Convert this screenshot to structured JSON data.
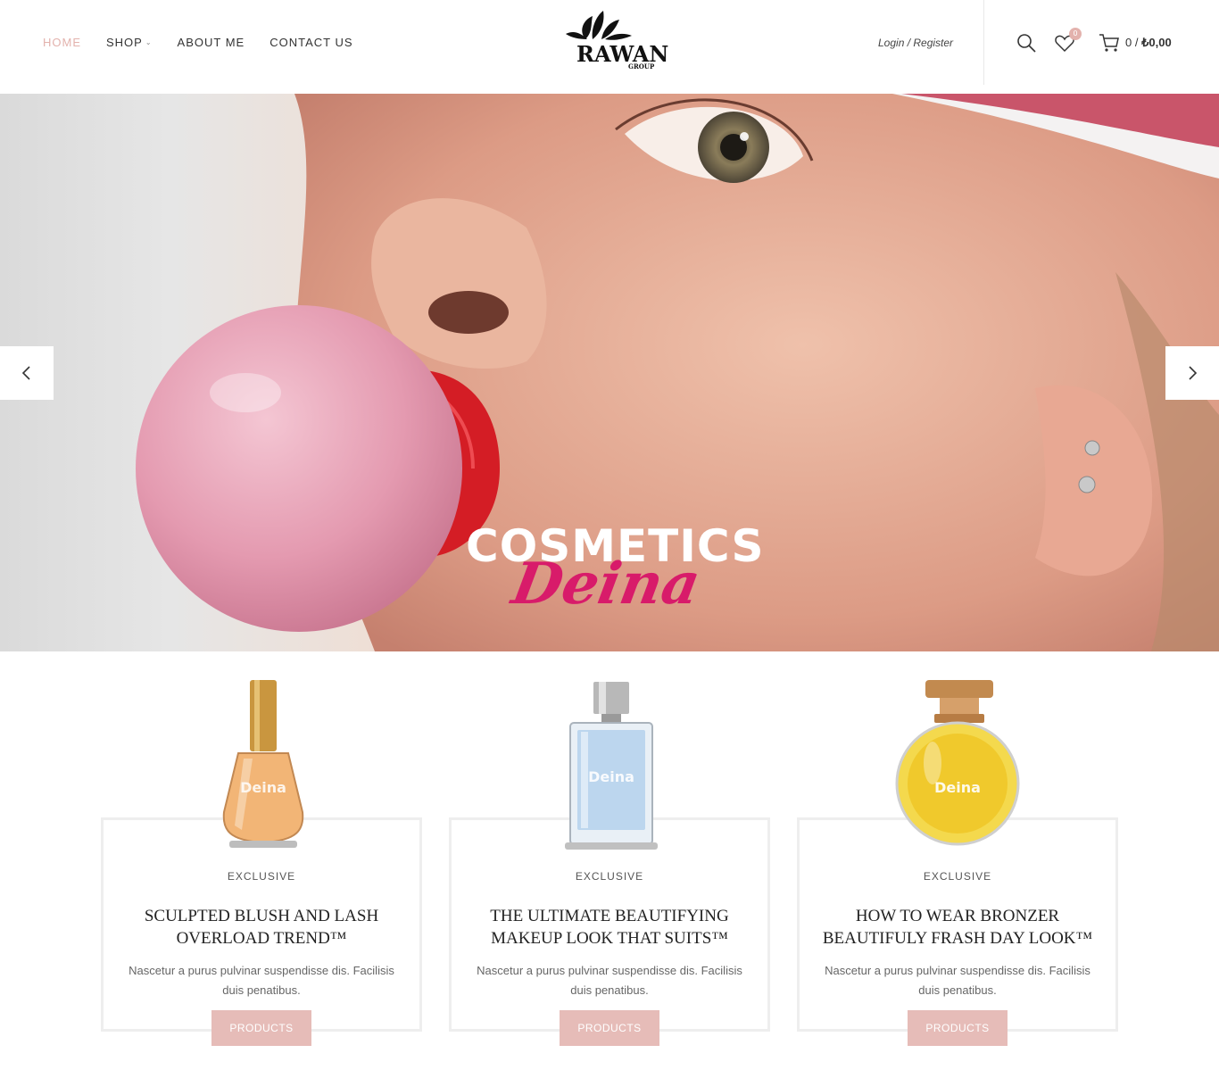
{
  "header": {
    "nav": [
      {
        "label": "HOME",
        "active": true
      },
      {
        "label": "SHOP",
        "has_dropdown": true
      },
      {
        "label": "ABOUT ME"
      },
      {
        "label": "CONTACT US"
      }
    ],
    "logo": {
      "name": "RAWAN",
      "sub": "GROUP"
    },
    "login_label": "Login / Register",
    "wishlist_count": "0",
    "cart_count": "0",
    "cart_sep": "/",
    "cart_total": "₺0,00",
    "icons": [
      "search-icon",
      "heart-icon",
      "cart-icon"
    ]
  },
  "hero": {
    "title": "COSMETICS",
    "script": "Deina",
    "prev_icon": "chevron-left-icon",
    "next_icon": "chevron-right-icon"
  },
  "cards": [
    {
      "category": "EXCLUSIVE",
      "title": "SCULPTED BLUSH AND LASH OVERLOAD TREND™",
      "desc": "Nascetur a purus pulvinar suspendisse dis. Facilisis duis penatibus.",
      "button": "PRODUCTS",
      "bottle_label": "Deina"
    },
    {
      "category": "EXCLUSIVE",
      "title": "THE ULTIMATE BEAUTIFYING MAKEUP LOOK THAT SUITS™",
      "desc": "Nascetur a purus pulvinar suspendisse dis. Facilisis duis penatibus.",
      "button": "PRODUCTS",
      "bottle_label": "Deina"
    },
    {
      "category": "EXCLUSIVE",
      "title": "HOW TO WEAR BRONZER BEAUTIFULY FRASH DAY LOOK™",
      "desc": "Nascetur a purus pulvinar suspendisse dis. Facilisis duis penatibus.",
      "button": "PRODUCTS",
      "bottle_label": "Deina"
    }
  ],
  "colors": {
    "accent": "#e3b2ad",
    "button": "#e6bcb8",
    "script": "#d81b6a"
  }
}
